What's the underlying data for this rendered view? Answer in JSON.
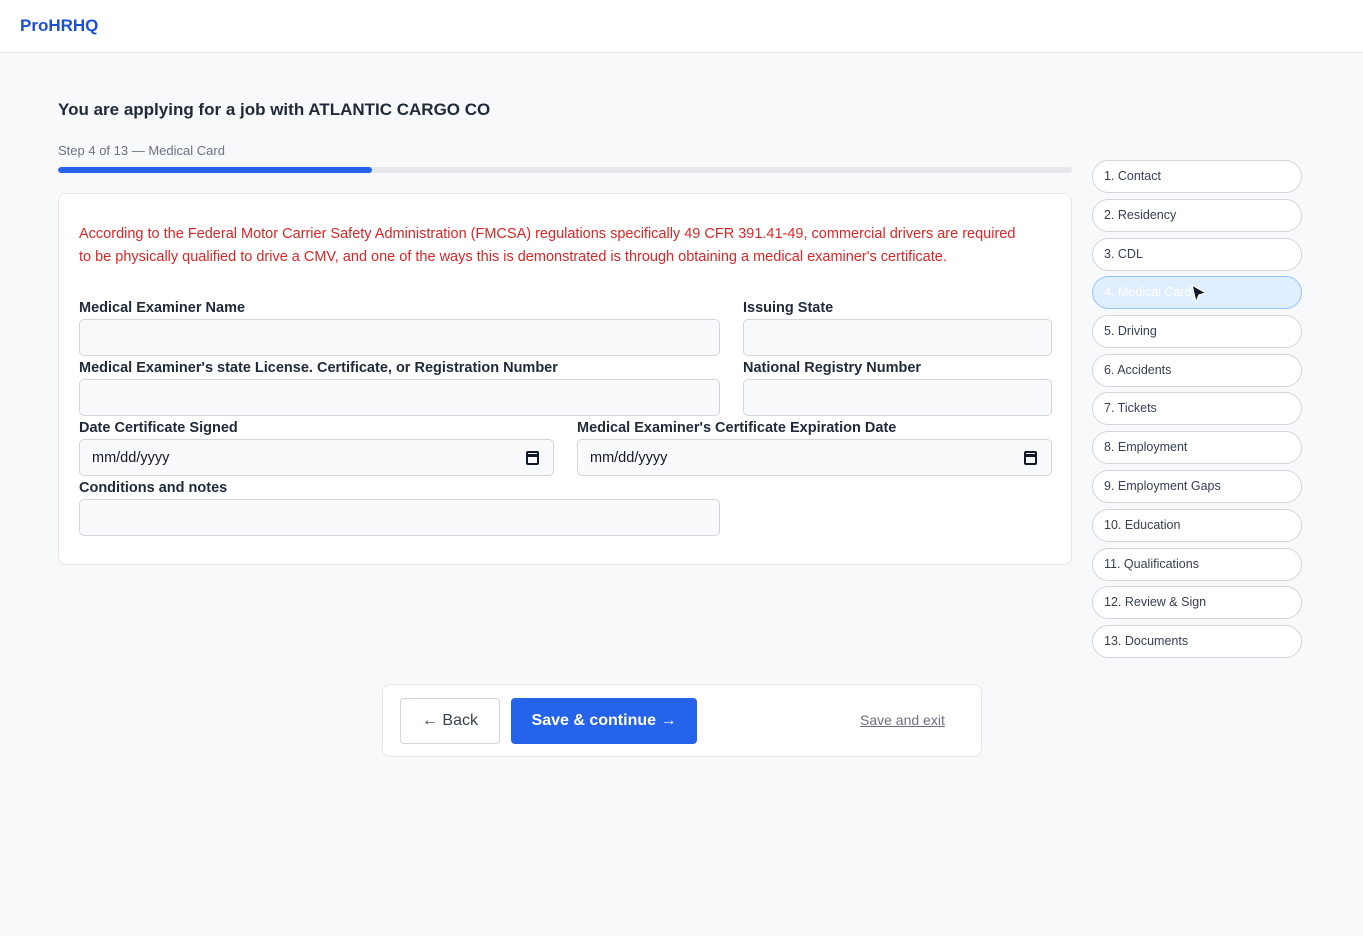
{
  "header": {
    "brand": "ProHRHQ"
  },
  "main": {
    "title": "You are applying for a job with ATLANTIC CARGO CO",
    "step_label": "Step 4 of 13 — Medical Card",
    "progress_fraction": 0.31
  },
  "form": {
    "notice": "According to the Federal Motor Carrier Safety Administration (FMCSA) regulations specifically 49 CFR 391.41-49, commercial drivers are required to be physically qualified to drive a CMV, and one of the ways this is demonstrated is through obtaining a medical examiner's certificate.",
    "examiner_name": {
      "label": "Medical Examiner Name",
      "value": ""
    },
    "issuing_state": {
      "label": "Issuing State",
      "value": ""
    },
    "license_number": {
      "label": "Medical Examiner's state License. Certificate, or Registration Number",
      "value": ""
    },
    "registry_number": {
      "label": "National Registry Number",
      "value": ""
    },
    "date_signed": {
      "label": "Date Certificate Signed",
      "value": "mm/dd/yyyy"
    },
    "expiration_date": {
      "label": "Medical Examiner's Certificate Expiration Date",
      "value": "mm/dd/yyyy"
    },
    "notes": {
      "label": "Conditions and notes",
      "value": ""
    }
  },
  "sidebar": {
    "items": [
      {
        "label": "1. Contact"
      },
      {
        "label": "2. Residency"
      },
      {
        "label": "3. CDL"
      },
      {
        "label": "4. Medical Card",
        "active": true
      },
      {
        "label": "5. Driving"
      },
      {
        "label": "6. Accidents"
      },
      {
        "label": "7. Tickets"
      },
      {
        "label": "8. Employment"
      },
      {
        "label": "9. Employment Gaps"
      },
      {
        "label": "10. Education"
      },
      {
        "label": "11. Qualifications"
      },
      {
        "label": "12. Review & Sign"
      },
      {
        "label": "13. Documents"
      }
    ]
  },
  "actions": {
    "back_label": "← Back",
    "save_label": "Save & continue →",
    "exit_label": "Save and exit"
  },
  "colors": {
    "accent": "#2563eb",
    "brand": "#1d4ed8",
    "notice": "#dc2626"
  }
}
